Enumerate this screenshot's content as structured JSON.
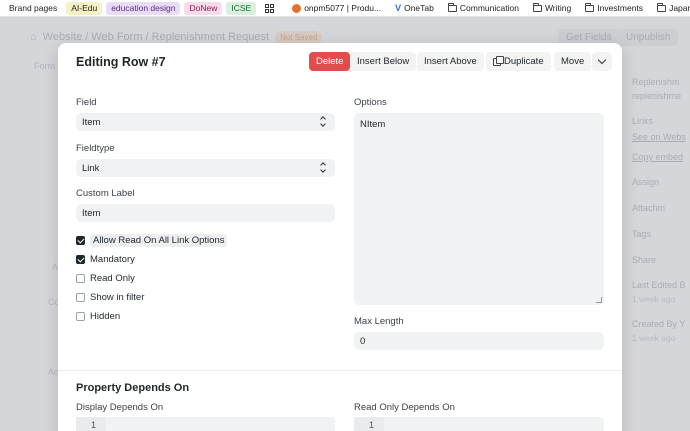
{
  "bookmarks": [
    {
      "label": "Brand pages",
      "style": ""
    },
    {
      "label": "AI-Edu",
      "style": "pill-yellow"
    },
    {
      "label": "education design",
      "style": "pill-purple"
    },
    {
      "label": "DoNew",
      "style": "pill-pink"
    },
    {
      "label": "ICSE",
      "style": "pill-green"
    }
  ],
  "bookmarks_right": {
    "onpm": "onpm5077 | Produ...",
    "onetab": "OneTab",
    "communication": "Communication",
    "writing": "Writing",
    "investments": "Investments",
    "japan": "Japan"
  },
  "background": {
    "breadcrumb": "Website / Web Form / Replenishment Request",
    "not_saved": "Not Saved",
    "get_fields": "Get Fields",
    "unpublish": "Unpublish",
    "right_panel": {
      "title": "Replenishm",
      "subtitle": "replenishme",
      "links": "Links",
      "see_on_website": "See on Webs",
      "copy_embed": "Copy embed",
      "assign": "Assign",
      "attachments": "Attachm",
      "tags": "Tags",
      "share": "Share",
      "last_edited": "Last Edited B",
      "last_edited_time": "1 week ago",
      "created_by": "Created By Y",
      "created_time": "1 week ago"
    },
    "left_panel": {
      "form": "Form",
      "co": "Co",
      "ac": "Ac",
      "a": "A"
    }
  },
  "modal": {
    "title": "Editing Row #7",
    "buttons": {
      "delete": "Delete",
      "insert_below": "Insert Below",
      "insert_above": "Insert Above",
      "duplicate": "Duplicate",
      "move": "Move"
    },
    "field": {
      "label": "Field",
      "value": "Item"
    },
    "fieldtype": {
      "label": "Fieldtype",
      "value": "Link"
    },
    "custom_label": {
      "label": "Custom Label",
      "value": "Item"
    },
    "checkboxes": [
      {
        "label": "Allow Read On All Link Options",
        "checked": true
      },
      {
        "label": "Mandatory",
        "checked": true
      },
      {
        "label": "Read Only",
        "checked": false
      },
      {
        "label": "Show in filter",
        "checked": false
      },
      {
        "label": "Hidden",
        "checked": false
      }
    ],
    "options": {
      "label": "Options",
      "value": "NItem"
    },
    "max_length": {
      "label": "Max Length",
      "value": "0"
    },
    "section": "Property Depends On",
    "display_depends_on": {
      "label": "Display Depends On",
      "line": "1"
    },
    "read_only_depends_on": {
      "label": "Read Only Depends On",
      "line": "1"
    }
  }
}
